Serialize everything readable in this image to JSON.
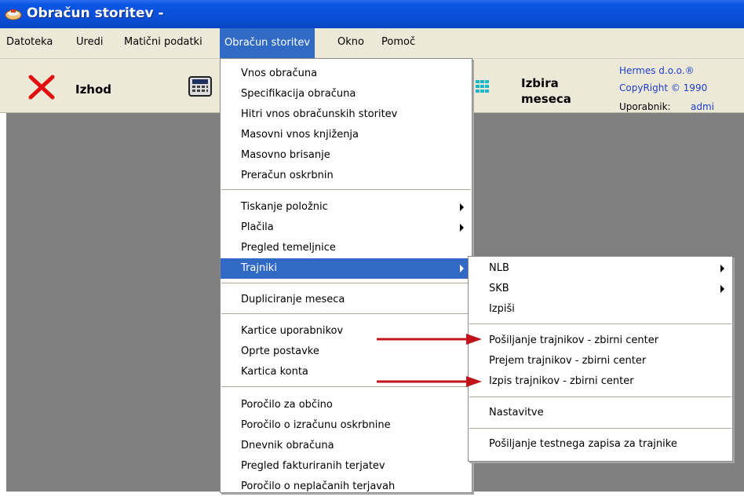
{
  "window": {
    "title": "Obračun storitev -"
  },
  "menubar": {
    "items": [
      {
        "label": "Datoteka"
      },
      {
        "label": "Uredi"
      },
      {
        "label": "Matični podatki"
      },
      {
        "label": "Obračun storitev"
      },
      {
        "label": "Okno"
      },
      {
        "label": "Pomoč"
      }
    ]
  },
  "toolbar": {
    "exit_label": "Izhod",
    "month_label_1": "Izbira",
    "month_label_2": "meseca",
    "company": "Hermes d.o.o.®",
    "copyright": "CopyRight © 1990",
    "user_label": "Uporabnik:",
    "user_value": "admi"
  },
  "main_menu": {
    "items": [
      {
        "label": "Vnos obračuna"
      },
      {
        "label": "Specifikacija obračuna"
      },
      {
        "label": "Hitri vnos obračunskih storitev"
      },
      {
        "label": "Masovni vnos knjiženja"
      },
      {
        "label": "Masovno brisanje"
      },
      {
        "label": "Preračun oskrbnin"
      },
      {
        "label": "Tiskanje položnic"
      },
      {
        "label": "Plačila"
      },
      {
        "label": "Pregled temeljnice"
      },
      {
        "label": "Trajniki"
      },
      {
        "label": "Dupliciranje meseca"
      },
      {
        "label": "Kartice uporabnikov"
      },
      {
        "label": "Oprte postavke"
      },
      {
        "label": "Kartica konta"
      },
      {
        "label": "Poročilo za občino"
      },
      {
        "label": "Poročilo o izračunu oskrbnine"
      },
      {
        "label": "Dnevnik obračuna"
      },
      {
        "label": "Pregled fakturiranih terjatev"
      },
      {
        "label": "Poročilo o neplačanih terjavah"
      }
    ]
  },
  "submenu": {
    "items": [
      {
        "label": "NLB"
      },
      {
        "label": "SKB"
      },
      {
        "label": "Izpiši"
      },
      {
        "label": "Pošiljanje trajnikov - zbirni center"
      },
      {
        "label": "Prejem trajnikov - zbirni center"
      },
      {
        "label": "Izpis trajnikov - zbirni center"
      },
      {
        "label": "Nastavitve"
      },
      {
        "label": "Pošiljanje testnega zapisa za trajnike"
      }
    ]
  },
  "colors": {
    "titlebar": "#0a4fd6",
    "highlight": "#316ac5",
    "arrow": "#c0141c",
    "workspace": "#808080"
  }
}
